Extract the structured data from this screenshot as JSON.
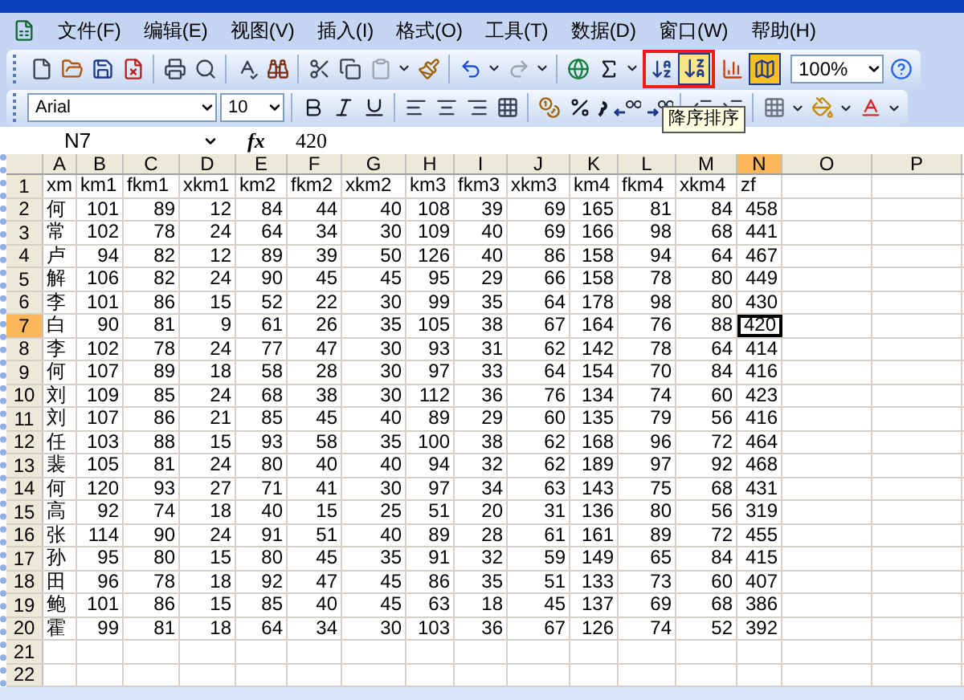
{
  "menu": [
    "文件(F)",
    "编辑(E)",
    "视图(V)",
    "插入(I)",
    "格式(O)",
    "工具(T)",
    "数据(D)",
    "窗口(W)",
    "帮助(H)"
  ],
  "standard_toolbar": {
    "zoom": "100%",
    "highlighted_group": true
  },
  "formatting_toolbar": {
    "font": "Arial",
    "size": "10"
  },
  "tooltip": "降序排序",
  "formula_bar": {
    "name_box": "N7",
    "fx": "fx",
    "value": "420"
  },
  "columns": [
    {
      "label": "A",
      "selected": false
    },
    {
      "label": "B",
      "selected": false
    },
    {
      "label": "C",
      "selected": false
    },
    {
      "label": "D",
      "selected": false
    },
    {
      "label": "E",
      "selected": false
    },
    {
      "label": "F",
      "selected": false
    },
    {
      "label": "G",
      "selected": false
    },
    {
      "label": "H",
      "selected": false
    },
    {
      "label": "I",
      "selected": false
    },
    {
      "label": "J",
      "selected": false
    },
    {
      "label": "K",
      "selected": false
    },
    {
      "label": "L",
      "selected": false
    },
    {
      "label": "M",
      "selected": false
    },
    {
      "label": "N",
      "selected": true
    },
    {
      "label": "O",
      "selected": false
    },
    {
      "label": "P",
      "selected": false
    }
  ],
  "rows": [
    {
      "number": "1",
      "selected": false,
      "cells": [
        "xm",
        "km1",
        "fkm1",
        "xkm1",
        "km2",
        "fkm2",
        "xkm2",
        "km3",
        "fkm3",
        "xkm3",
        "km4",
        "fkm4",
        "xkm4",
        "zf"
      ]
    },
    {
      "number": "2",
      "selected": false,
      "cells": [
        "何",
        "101",
        "89",
        "12",
        "84",
        "44",
        "40",
        "108",
        "39",
        "69",
        "165",
        "81",
        "84",
        "458"
      ]
    },
    {
      "number": "3",
      "selected": false,
      "cells": [
        "常",
        "102",
        "78",
        "24",
        "64",
        "34",
        "30",
        "109",
        "40",
        "69",
        "166",
        "98",
        "68",
        "441"
      ]
    },
    {
      "number": "4",
      "selected": false,
      "cells": [
        "卢",
        "94",
        "82",
        "12",
        "89",
        "39",
        "50",
        "126",
        "40",
        "86",
        "158",
        "94",
        "64",
        "467"
      ]
    },
    {
      "number": "5",
      "selected": false,
      "cells": [
        "解",
        "106",
        "82",
        "24",
        "90",
        "45",
        "45",
        "95",
        "29",
        "66",
        "158",
        "78",
        "80",
        "449"
      ]
    },
    {
      "number": "6",
      "selected": false,
      "cells": [
        "李",
        "101",
        "86",
        "15",
        "52",
        "22",
        "30",
        "99",
        "35",
        "64",
        "178",
        "98",
        "80",
        "430"
      ]
    },
    {
      "number": "7",
      "selected": true,
      "cells": [
        "白",
        "90",
        "81",
        "9",
        "61",
        "26",
        "35",
        "105",
        "38",
        "67",
        "164",
        "76",
        "88",
        "420"
      ]
    },
    {
      "number": "8",
      "selected": false,
      "cells": [
        "李",
        "102",
        "78",
        "24",
        "77",
        "47",
        "30",
        "93",
        "31",
        "62",
        "142",
        "78",
        "64",
        "414"
      ]
    },
    {
      "number": "9",
      "selected": false,
      "cells": [
        "何",
        "107",
        "89",
        "18",
        "58",
        "28",
        "30",
        "97",
        "33",
        "64",
        "154",
        "70",
        "84",
        "416"
      ]
    },
    {
      "number": "10",
      "selected": false,
      "cells": [
        "刘",
        "109",
        "85",
        "24",
        "68",
        "38",
        "30",
        "112",
        "36",
        "76",
        "134",
        "74",
        "60",
        "423"
      ]
    },
    {
      "number": "11",
      "selected": false,
      "cells": [
        "刘",
        "107",
        "86",
        "21",
        "85",
        "45",
        "40",
        "89",
        "29",
        "60",
        "135",
        "79",
        "56",
        "416"
      ]
    },
    {
      "number": "12",
      "selected": false,
      "cells": [
        "任",
        "103",
        "88",
        "15",
        "93",
        "58",
        "35",
        "100",
        "38",
        "62",
        "168",
        "96",
        "72",
        "464"
      ]
    },
    {
      "number": "13",
      "selected": false,
      "cells": [
        "裴",
        "105",
        "81",
        "24",
        "80",
        "40",
        "40",
        "94",
        "32",
        "62",
        "189",
        "97",
        "92",
        "468"
      ]
    },
    {
      "number": "14",
      "selected": false,
      "cells": [
        "何",
        "120",
        "93",
        "27",
        "71",
        "41",
        "30",
        "97",
        "34",
        "63",
        "143",
        "75",
        "68",
        "431"
      ]
    },
    {
      "number": "15",
      "selected": false,
      "cells": [
        "高",
        "92",
        "74",
        "18",
        "40",
        "15",
        "25",
        "51",
        "20",
        "31",
        "136",
        "80",
        "56",
        "319"
      ]
    },
    {
      "number": "16",
      "selected": false,
      "cells": [
        "张",
        "114",
        "90",
        "24",
        "91",
        "51",
        "40",
        "89",
        "28",
        "61",
        "161",
        "89",
        "72",
        "455"
      ]
    },
    {
      "number": "17",
      "selected": false,
      "cells": [
        "孙",
        "95",
        "80",
        "15",
        "80",
        "45",
        "35",
        "91",
        "32",
        "59",
        "149",
        "65",
        "84",
        "415"
      ]
    },
    {
      "number": "18",
      "selected": false,
      "cells": [
        "田",
        "96",
        "78",
        "18",
        "92",
        "47",
        "45",
        "86",
        "35",
        "51",
        "133",
        "73",
        "60",
        "407"
      ]
    },
    {
      "number": "19",
      "selected": false,
      "cells": [
        "鲍",
        "101",
        "86",
        "15",
        "85",
        "40",
        "45",
        "63",
        "18",
        "45",
        "137",
        "69",
        "68",
        "386"
      ]
    },
    {
      "number": "20",
      "selected": false,
      "cells": [
        "霍",
        "99",
        "81",
        "18",
        "64",
        "34",
        "30",
        "103",
        "36",
        "67",
        "126",
        "74",
        "52",
        "392"
      ]
    },
    {
      "number": "21",
      "selected": false
    },
    {
      "number": "22",
      "selected": false
    }
  ]
}
